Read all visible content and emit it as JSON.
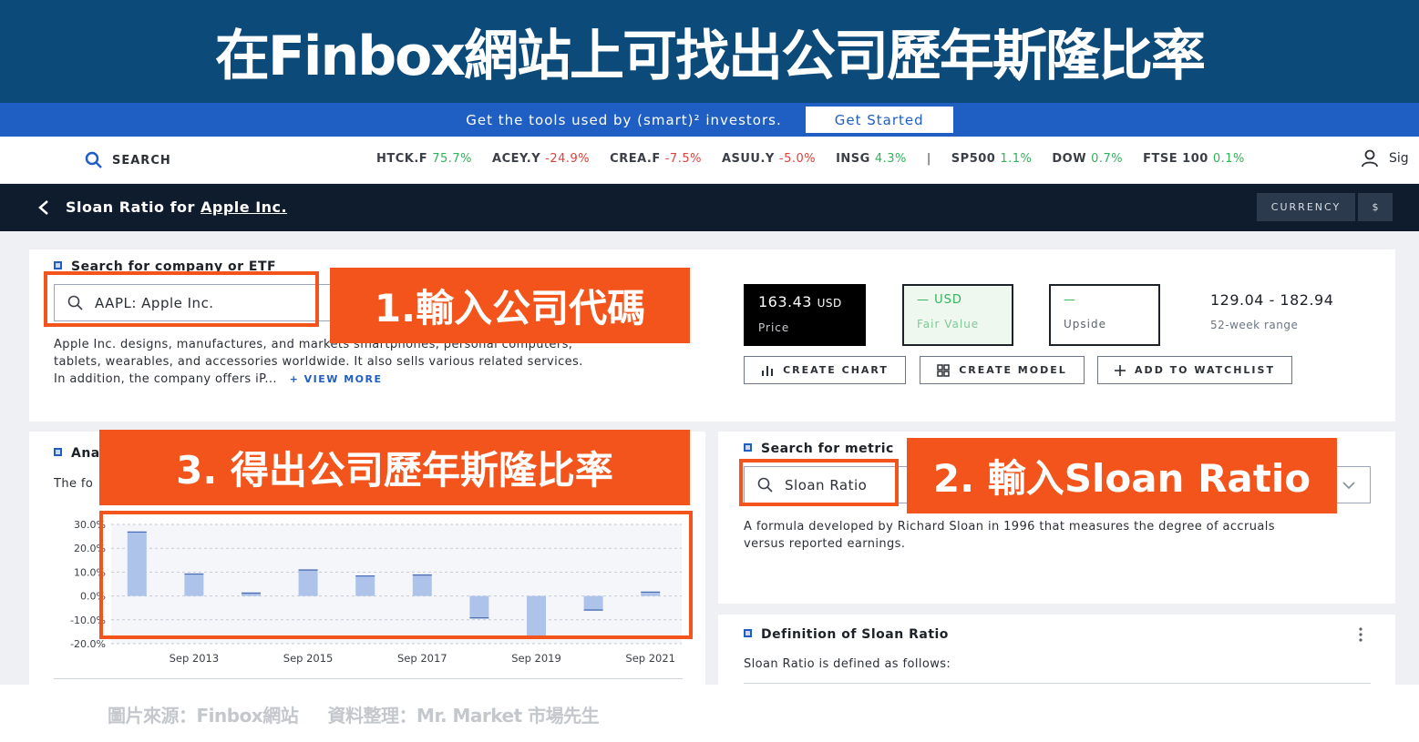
{
  "banner": {
    "title": "在Finbox網站上可找出公司歷年斯隆比率"
  },
  "promo": {
    "text": "Get the tools used by (smart)² investors.",
    "button": "Get Started"
  },
  "nav": {
    "search_label": "SEARCH",
    "tickers": [
      {
        "symbol": "HTCK.F",
        "change": "75.7%",
        "dir": "up"
      },
      {
        "symbol": "ACEY.Y",
        "change": "-24.9%",
        "dir": "down"
      },
      {
        "symbol": "CREA.F",
        "change": "-7.5%",
        "dir": "down"
      },
      {
        "symbol": "ASUU.Y",
        "change": "-5.0%",
        "dir": "down"
      },
      {
        "symbol": "INSG",
        "change": "4.3%",
        "dir": "up"
      }
    ],
    "separator": "|",
    "indices": [
      {
        "symbol": "SP500",
        "change": "1.1%",
        "dir": "up"
      },
      {
        "symbol": "DOW",
        "change": "0.7%",
        "dir": "up"
      },
      {
        "symbol": "FTSE 100",
        "change": "0.1%",
        "dir": "up"
      }
    ],
    "signin": "Sig"
  },
  "header": {
    "title_prefix": "Sloan Ratio for",
    "company_link": "Apple Inc.",
    "currency_label": "CURRENCY",
    "currency_value": "$"
  },
  "company_search": {
    "label": "Search for company or ETF",
    "value": "AAPL: Apple Inc.",
    "description_1": "Apple Inc. designs, manufactures, and markets smartphones, personal computers,",
    "description_2": "tablets, wearables, and accessories worldwide. It also sells various related services.",
    "description_3": "In addition, the company offers iP...",
    "view_more": "+ VIEW MORE"
  },
  "stats": {
    "price_value": "163.43",
    "price_unit": "USD",
    "price_label": "Price",
    "fair_value": "— USD",
    "fair_label": "Fair Value",
    "upside_value": "—",
    "upside_label": "Upside",
    "range_value": "129.04 - 182.94",
    "range_label": "52-week range"
  },
  "actions": {
    "create_chart": "CREATE CHART",
    "create_model": "CREATE MODEL",
    "watchlist": "ADD TO WATCHLIST"
  },
  "analysis": {
    "label": "Ana",
    "desc": "The fo"
  },
  "metric_search": {
    "label": "Search for metric",
    "value": "Sloan Ratio",
    "description_1": "A formula developed by Richard Sloan in 1996 that measures the degree of accruals",
    "description_2": "versus reported earnings."
  },
  "definition": {
    "label": "Definition of Sloan Ratio",
    "text": "Sloan Ratio is defined as follows:"
  },
  "annotations": {
    "step1": "1.輸入公司代碼",
    "step2": "2. 輸入Sloan Ratio",
    "step3": "3. 得出公司歷年斯隆比率"
  },
  "footer": {
    "source": "圖片來源：Finbox網站",
    "credit": "資料整理：Mr. Market 市場先生"
  },
  "colors": {
    "accent": "#1f5fc4",
    "annotation": "#f2541b",
    "bar": "#aec3ea",
    "up": "#2fb35a",
    "down": "#e2403a"
  },
  "chart_data": {
    "type": "bar",
    "ylim": [
      -20,
      30
    ],
    "ytick_labels": [
      "30.0%",
      "20.0%",
      "10.0%",
      "0.0%",
      "-10.0%",
      "-20.0%"
    ],
    "yticks": [
      30,
      20,
      10,
      0,
      -10,
      -20
    ],
    "x_labels": [
      "Sep 2013",
      "Sep 2015",
      "Sep 2017",
      "Sep 2019",
      "Sep 2021"
    ],
    "categories": [
      "Sep 2012",
      "Sep 2013",
      "Sep 2014",
      "Sep 2015",
      "Sep 2016",
      "Sep 2017",
      "Sep 2018",
      "Sep 2019",
      "Sep 2020",
      "Sep 2021"
    ],
    "values": [
      26.8,
      9.2,
      1.2,
      10.9,
      8.4,
      8.8,
      -9.2,
      -17.0,
      -5.9,
      1.6
    ]
  }
}
